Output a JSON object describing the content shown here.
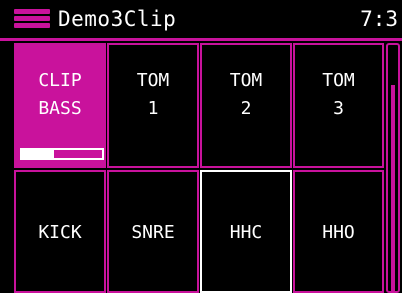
{
  "header": {
    "title": "Demo3Clip",
    "time": "7:3"
  },
  "pads": [
    {
      "line1": "CLIP",
      "line2": "BASS",
      "active": true,
      "progress": 0.4
    },
    {
      "line1": "TOM",
      "line2": "1"
    },
    {
      "line1": "TOM",
      "line2": "2"
    },
    {
      "line1": "TOM",
      "line2": "3"
    },
    {
      "line1": "KICK",
      "line2": ""
    },
    {
      "line1": "SNRE",
      "line2": ""
    },
    {
      "line1": "HHC",
      "line2": "",
      "selected": true
    },
    {
      "line1": "HHO",
      "line2": ""
    }
  ],
  "colors": {
    "accent": "#c9129c",
    "selected_border": "#ffffff",
    "background": "#000000"
  }
}
